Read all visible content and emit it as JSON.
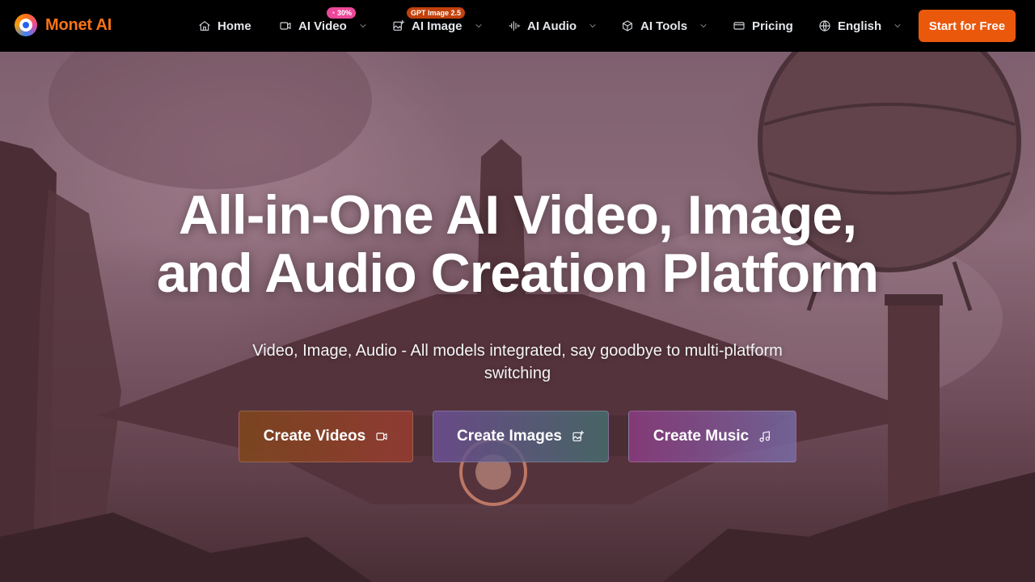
{
  "brand": {
    "name": "Monet AI"
  },
  "nav": {
    "items": [
      {
        "label": "Home",
        "icon": "home-icon"
      },
      {
        "label": "AI Video",
        "icon": "video-camera-icon",
        "badge": "30%"
      },
      {
        "label": "AI Image",
        "icon": "image-plus-icon",
        "badge": "GPT Image 2.5"
      },
      {
        "label": "AI Audio",
        "icon": "audio-waveform-icon"
      },
      {
        "label": "AI Tools",
        "icon": "cube-icon"
      },
      {
        "label": "Pricing",
        "icon": "credit-card-icon"
      },
      {
        "label": "English",
        "icon": "globe-icon"
      }
    ],
    "cta_label": "Start for Free"
  },
  "hero": {
    "headline_line1": "All-in-One AI Video, Image,",
    "headline_line2": "and Audio Creation Platform",
    "subheadline": "Video, Image, Audio - All models integrated, say goodbye to multi-platform switching",
    "buttons": [
      {
        "label": "Create Videos",
        "icon": "video-camera-icon"
      },
      {
        "label": "Create Images",
        "icon": "image-plus-icon"
      },
      {
        "label": "Create Music",
        "icon": "music-note-icon"
      }
    ]
  },
  "colors": {
    "accent": "#ea580c",
    "brand": "#f97316",
    "badge_pink": "#ec4899",
    "badge_orange": "#c2410c"
  }
}
